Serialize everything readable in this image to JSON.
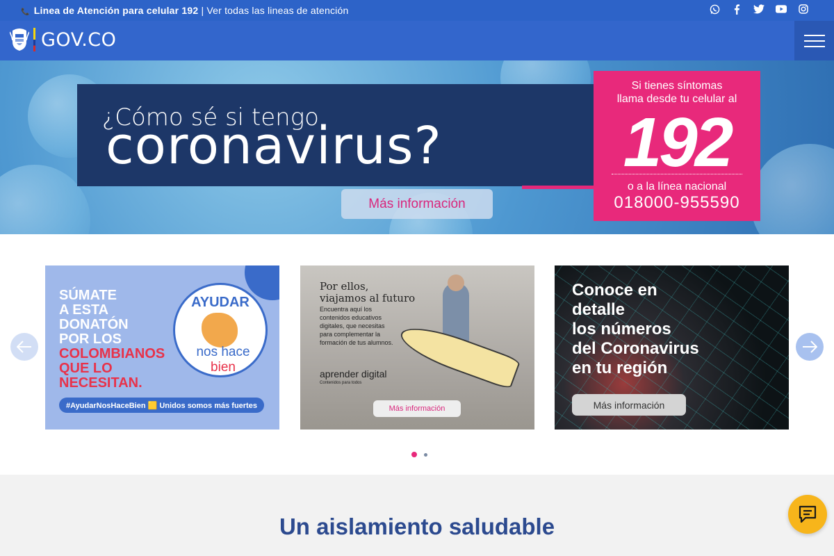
{
  "topbar": {
    "hotline_bold": "Linea de Atención para celular 192",
    "separator": "|",
    "all_lines_link": "Ver todas las lineas de atención",
    "social": [
      "whatsapp-icon",
      "facebook-icon",
      "twitter-icon",
      "youtube-icon",
      "instagram-icon"
    ]
  },
  "header": {
    "logo_text": "GOV.CO",
    "menu_icon": "hamburger-icon"
  },
  "hero": {
    "question_line1": "¿Cómo sé si tengo",
    "question_line2": "coronavirus?",
    "more_button": "Más información",
    "pink_line1": "Si tienes síntomas",
    "pink_line2": "llama desde tu celular al",
    "pink_number": "192",
    "pink_line3": "o a la línea nacional",
    "pink_phone": "018000-955590",
    "colors": {
      "pink": "#e8297b",
      "navy": "#1d3768"
    }
  },
  "carousel": {
    "prev_icon": "arrow-left-icon",
    "next_icon": "arrow-right-icon",
    "card1": {
      "l1": "SÚMATE",
      "l2": "A ESTA",
      "l3": "DONATÓN",
      "l4": "POR LOS",
      "l5": "COLOMBIANOS",
      "l6": "QUE LO",
      "l7": "NECESITAN.",
      "badge_top": "AYUDAR",
      "badge_bottom": "nos hace",
      "badge_bottom_red": "bien",
      "tag": "#AyudarNosHaceBien 🟨 Unidos somos más fuertes"
    },
    "card2": {
      "title1": "Por ellos,",
      "title2": "viajamos al futuro",
      "body": "Encuentra aquí los contenidos educativos digitales, que necesitas para complementar la formación de tus alumnos.",
      "brand": "aprender digital",
      "brand_sub": "Contenidos para todos",
      "button": "Más información"
    },
    "card3": {
      "l1": "Conoce en",
      "l2": "detalle",
      "l3": "los números",
      "l4": "del Coronavirus",
      "l5": "en tu región",
      "button": "Más información"
    },
    "dots": {
      "active": 1,
      "total": 2
    }
  },
  "section": {
    "title": "Un aislamiento saludable"
  },
  "chat": {
    "icon": "chat-icon"
  }
}
